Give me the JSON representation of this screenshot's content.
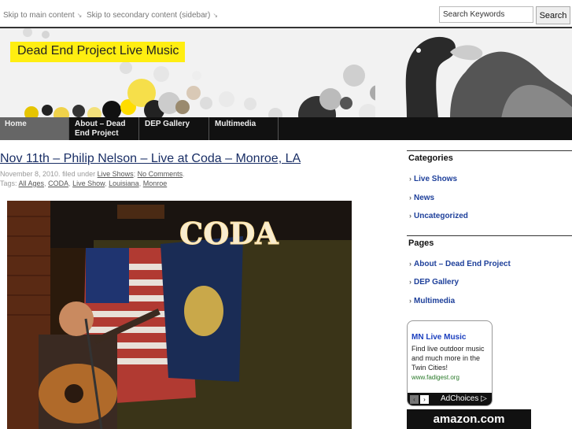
{
  "skip_links": {
    "main": "Skip to main content",
    "sidebar": "Skip to secondary content (sidebar)"
  },
  "search": {
    "placeholder": "Search Keywords",
    "value": "Search Keywords",
    "button": "Search"
  },
  "site": {
    "title": "Dead End Project Live Music"
  },
  "nav": {
    "items": [
      {
        "label": "Home"
      },
      {
        "label": "About – Dead End Project"
      },
      {
        "label": "DEP Gallery"
      },
      {
        "label": "Multimedia"
      }
    ]
  },
  "post": {
    "title": "Nov 11th – Philip Nelson – Live at Coda – Monroe, LA",
    "date": "November 8, 2010.",
    "filed_under_text": "filed under",
    "category": "Live Shows",
    "comments": "No Comments",
    "tags_label": "Tags:",
    "tags": [
      "All Ages",
      "CODA",
      "Live Show",
      "Louisiana",
      "Monroe"
    ],
    "photo_sign": "CODA"
  },
  "sidebar": {
    "categories_heading": "Categories",
    "categories": [
      "Live Shows",
      "News",
      "Uncategorized"
    ],
    "pages_heading": "Pages",
    "pages": [
      "About – Dead End Project",
      "DEP Gallery",
      "Multimedia"
    ]
  },
  "ad": {
    "title": "MN Live Music",
    "body": "Find live outdoor music and much more in the Twin Cities!",
    "url": "www.fadigest.org",
    "choices": "AdChoices",
    "prev": "‹",
    "next": "›"
  },
  "amazon": {
    "label": "amazon.com"
  },
  "colors": {
    "title_yellow": "#ffee11",
    "nav_bg": "#111111",
    "link_blue": "#1d3f9a",
    "post_title": "#1a2f66"
  }
}
